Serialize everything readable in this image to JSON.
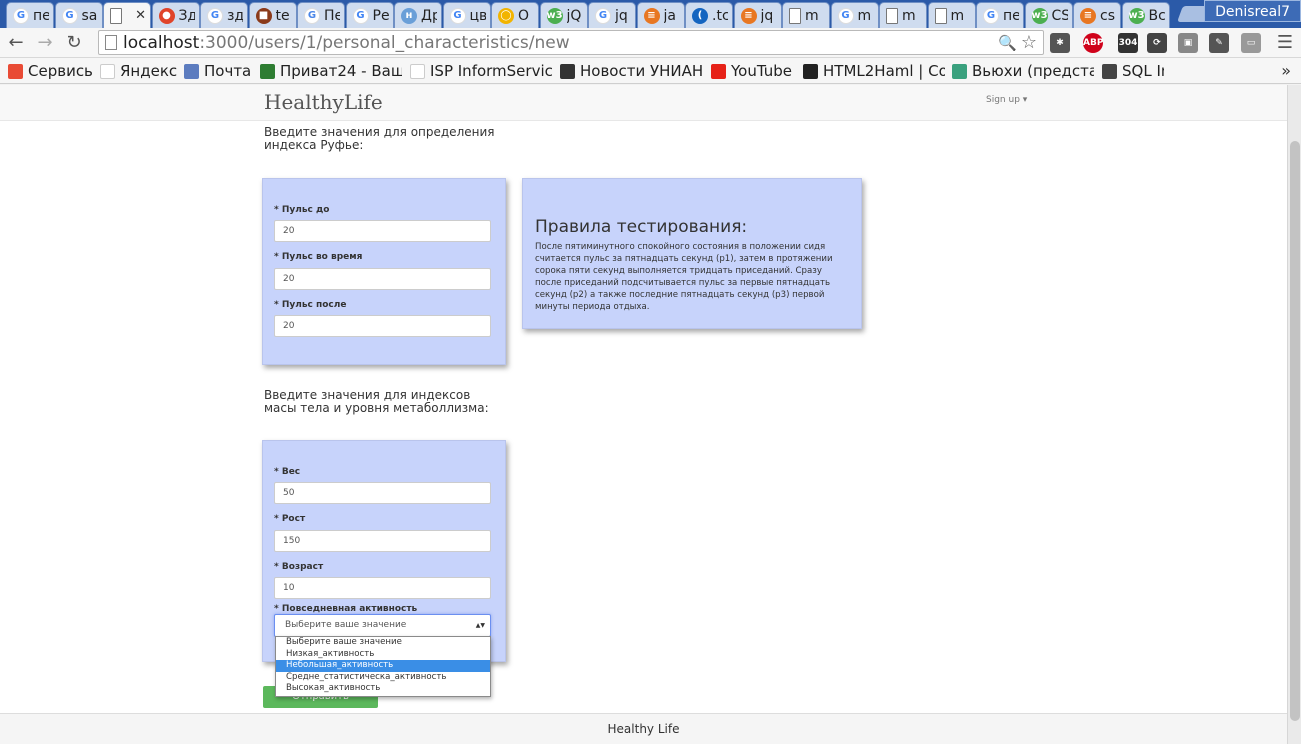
{
  "browser": {
    "tabs": [
      {
        "title": "пе",
        "fav_color": "#4285f4",
        "fav_char": "G"
      },
      {
        "title": "sa",
        "fav_color": "#4285f4",
        "fav_char": "G"
      },
      {
        "title": "",
        "fav_color": "#ffffff",
        "fav_char": "",
        "active": true
      },
      {
        "title": "Зд",
        "fav_color": "#e0442a",
        "fav_char": "●"
      },
      {
        "title": "зд",
        "fav_color": "#4285f4",
        "fav_char": "G"
      },
      {
        "title": "te",
        "fav_color": "#8b3a1a",
        "fav_char": "■"
      },
      {
        "title": "Пе",
        "fav_color": "#4a86e8",
        "fav_char": "G"
      },
      {
        "title": "Ре",
        "fav_color": "#4285f4",
        "fav_char": "G"
      },
      {
        "title": "Др",
        "fav_color": "#6a9fd8",
        "fav_char": "н"
      },
      {
        "title": "цв",
        "fav_color": "#4285f4",
        "fav_char": "G"
      },
      {
        "title": "О",
        "fav_color": "#f2b400",
        "fav_char": "◯"
      },
      {
        "title": "jQ",
        "fav_color": "#4caf50",
        "fav_char": "w3"
      },
      {
        "title": "jq",
        "fav_color": "#4285f4",
        "fav_char": "G"
      },
      {
        "title": "ja",
        "fav_color": "#e87722",
        "fav_char": "≡"
      },
      {
        "title": ".tc",
        "fav_color": "#1565c0",
        "fav_char": "("
      },
      {
        "title": "jq",
        "fav_color": "#e87722",
        "fav_char": "≡"
      },
      {
        "title": "m",
        "fav_color": "#ffffff",
        "fav_char": ""
      },
      {
        "title": "m",
        "fav_color": "#4285f4",
        "fav_char": "G"
      },
      {
        "title": "m",
        "fav_color": "#ffffff",
        "fav_char": ""
      },
      {
        "title": "m",
        "fav_color": "#ffffff",
        "fav_char": ""
      },
      {
        "title": "пе",
        "fav_color": "#4285f4",
        "fav_char": "G"
      },
      {
        "title": "CS",
        "fav_color": "#4caf50",
        "fav_char": "w3"
      },
      {
        "title": "cs",
        "fav_color": "#e87722",
        "fav_char": "≡"
      },
      {
        "title": "Вс",
        "fav_color": "#4caf50",
        "fav_char": "w3"
      }
    ],
    "close_glyph": "✕",
    "profile_name": "Denisreal7",
    "url_host": "localhost",
    "url_path": ":3000/users/1/personal_characteristics/new",
    "nav": {
      "back": "←",
      "forward": "→",
      "reload": "↻",
      "menu": "☰"
    },
    "zoom_glyph": "🔍",
    "star_glyph": "☆",
    "extensions": [
      {
        "name": "bug-extension",
        "color": "#555555",
        "label": "✱"
      },
      {
        "name": "adblock-extension",
        "color": "#d0021b",
        "label": "ABP"
      },
      {
        "name": "http-status-extension",
        "color": "#333333",
        "label": "304"
      },
      {
        "name": "sync-extension",
        "color": "#444444",
        "label": "⟳"
      },
      {
        "name": "puzzle-extension",
        "color": "#888888",
        "label": "▣"
      },
      {
        "name": "eyedropper-extension",
        "color": "#555555",
        "label": "✎"
      },
      {
        "name": "screen-extension",
        "color": "#999999",
        "label": "▭"
      }
    ],
    "bookmarks": [
      {
        "label": "Сервисы",
        "color": "#e94b35"
      },
      {
        "label": "Яндекс",
        "color": "#ffffff"
      },
      {
        "label": "Почта",
        "color": "#5c7cbf"
      },
      {
        "label": "Приват24 - Ваш и",
        "color": "#2e7d32"
      },
      {
        "label": "ISP InformService",
        "color": "#ffffff"
      },
      {
        "label": "Новости УНИАН",
        "color": "#333333"
      },
      {
        "label": "YouTube",
        "color": "#e62117"
      },
      {
        "label": "HTML2Haml | Con",
        "color": "#222222"
      },
      {
        "label": "Вьюхи (представ",
        "color": "#3aa17e"
      },
      {
        "label": "SQL In",
        "color": "#444444"
      }
    ],
    "bookmarks_more": "»"
  },
  "page": {
    "brand": "HealthyLife",
    "signup": "Sign up ▾",
    "ruffier_intro": "Введите значения для определения индекса Руфье:",
    "ruffier_fields": [
      {
        "label": "Пульс до",
        "value": "20"
      },
      {
        "label": "Пульс во время",
        "value": "20"
      },
      {
        "label": "Пульс после",
        "value": "20"
      }
    ],
    "required_mark": "*",
    "rules": {
      "title": "Правила тестирования:",
      "text": "После пятиминутного спокойного состояния в положении сидя считается пульс за пятнадцать секунд (p1), затем в протяжении сорока пяти секунд выполняется тридцать приседаний. Сразу после приседаний подсчитывается пульс за первые пятнадцать секунд (p2) а также последние пятнадцать секунд (p3) первой минуты периода отдыха."
    },
    "mass_intro": "Введите значения для индексов масы тела и уровня метаболлизма:",
    "mass_fields": [
      {
        "label": "Вес",
        "value": "50"
      },
      {
        "label": "Рост",
        "value": "150"
      },
      {
        "label": "Возраст",
        "value": "10"
      }
    ],
    "activity": {
      "label": "Повседневная активность",
      "selected": "Выберите ваше значение",
      "caret": "▲▼",
      "options": [
        {
          "label": "Выберите ваше значение",
          "highlighted": false
        },
        {
          "label": "Низкая_активность",
          "highlighted": false
        },
        {
          "label": "Небольшая_активность",
          "highlighted": true
        },
        {
          "label": "Средне_статистическа_активность",
          "highlighted": false
        },
        {
          "label": "Высокая_активность",
          "highlighted": false
        }
      ]
    },
    "submit_label": "Отправить параметры",
    "footer": "Healthy Life"
  }
}
